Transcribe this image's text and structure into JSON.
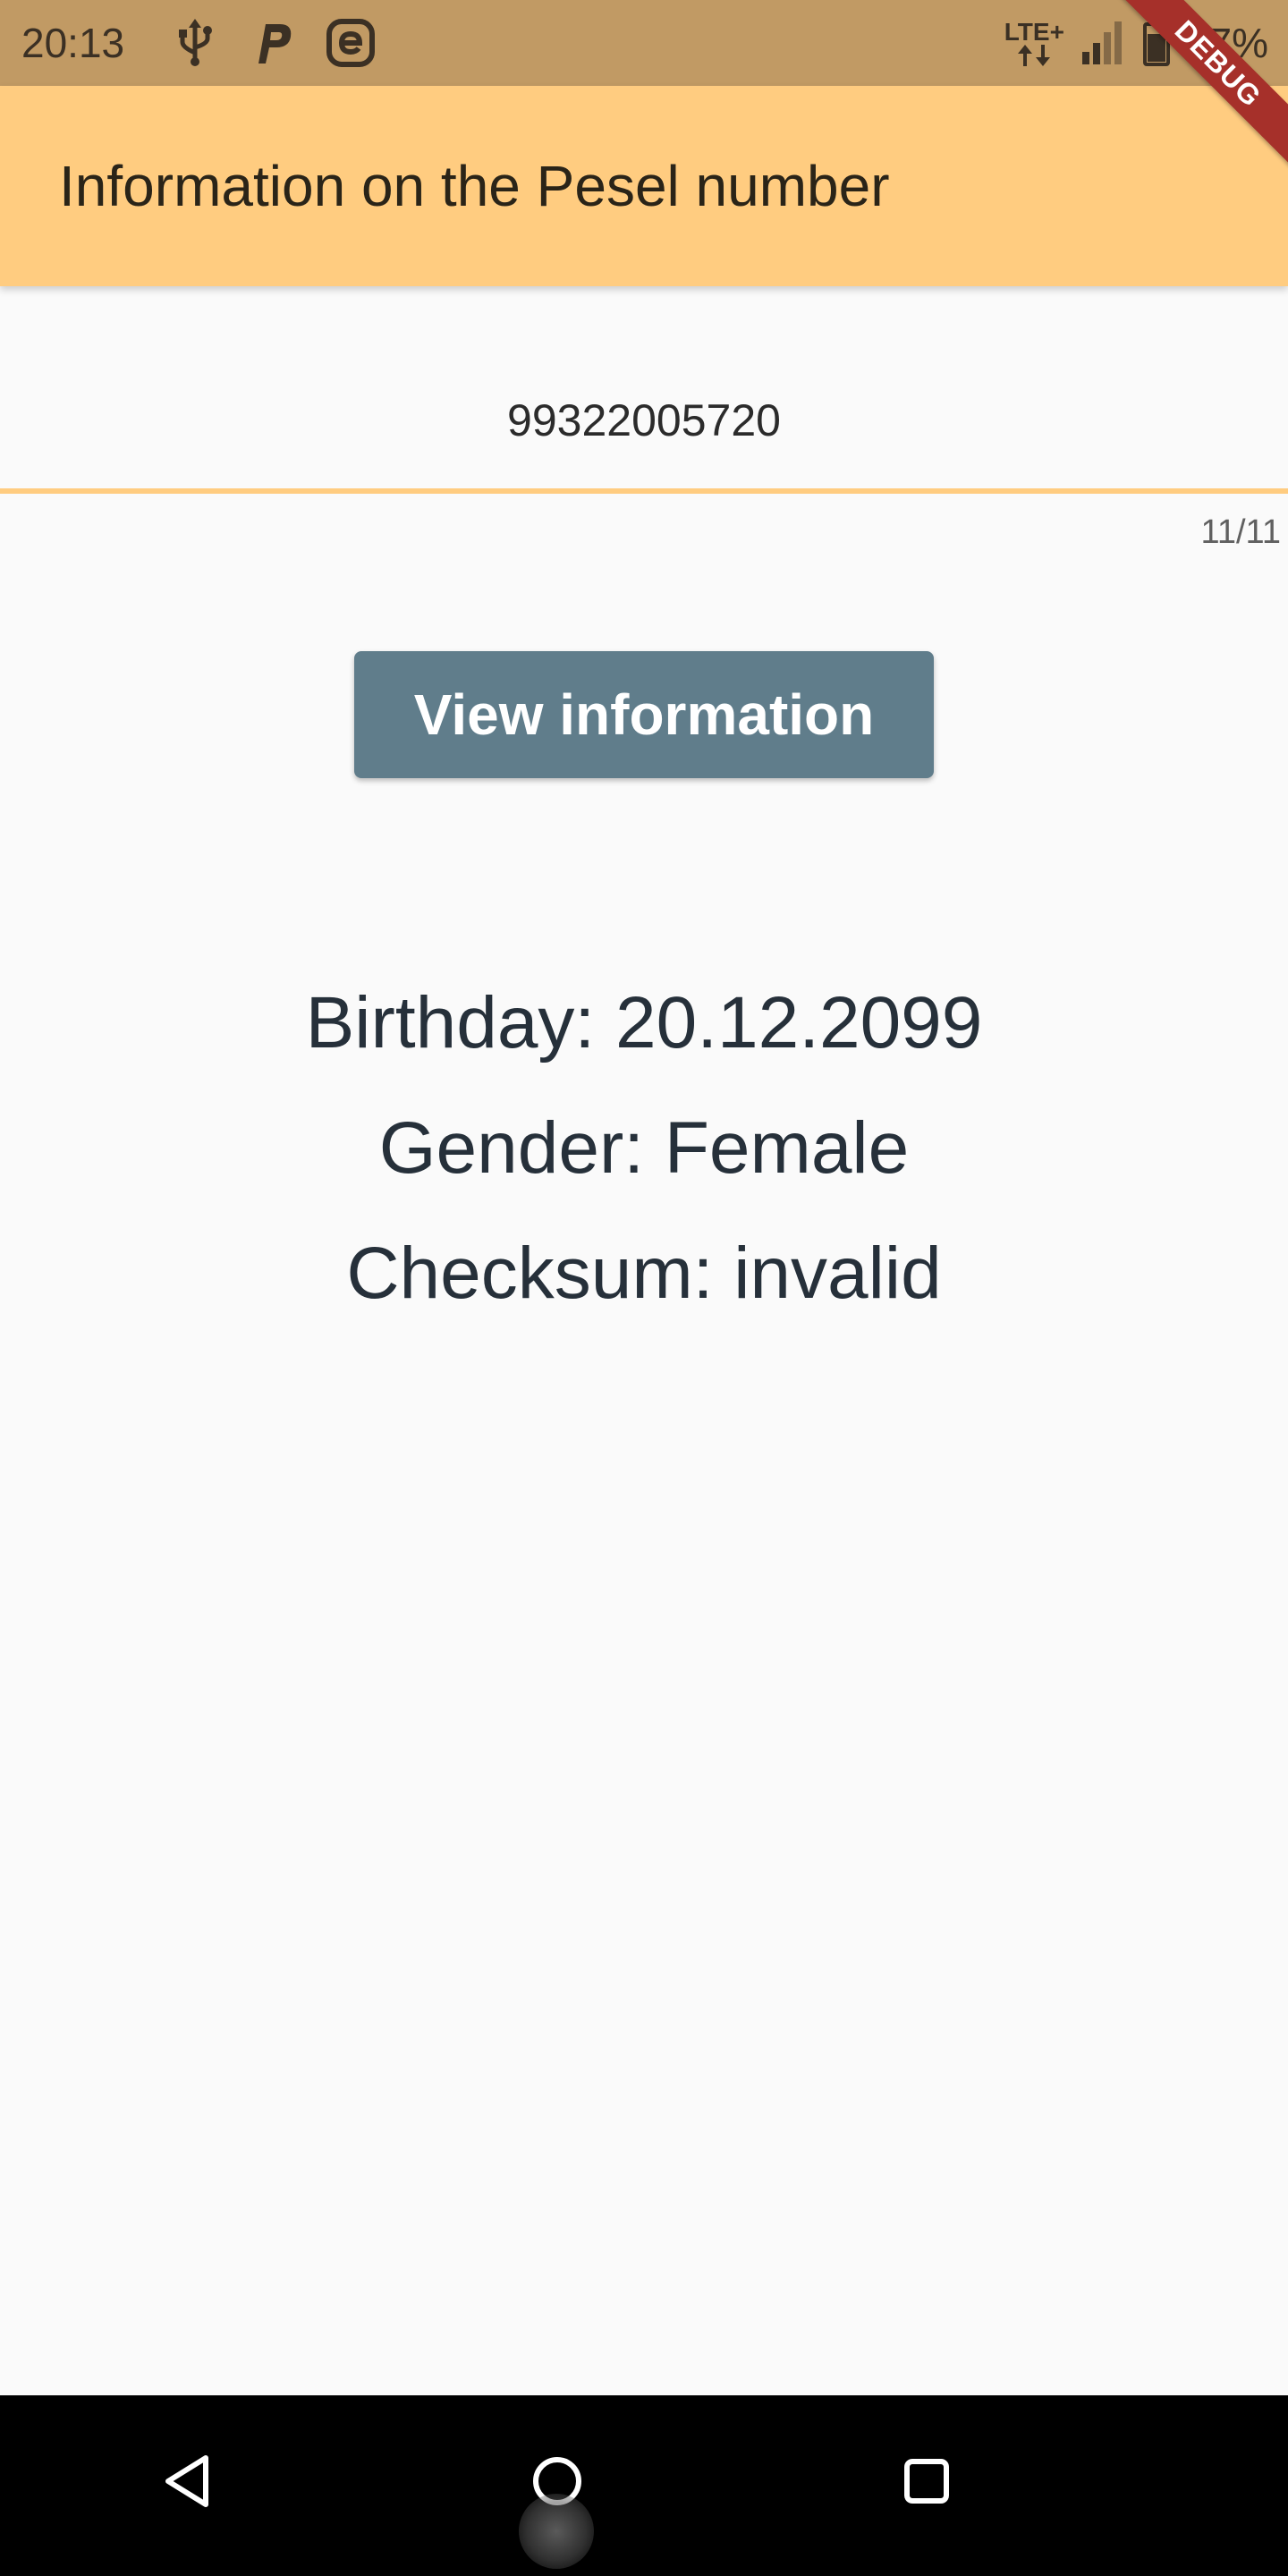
{
  "status_bar": {
    "time": "20:13",
    "network_label": "LTE+",
    "battery": "77%",
    "icons": [
      "usb-icon",
      "parking-icon",
      "e-app-icon",
      "lte-icon",
      "signal-icon",
      "battery-icon"
    ]
  },
  "debug_banner": "DEBUG",
  "app_bar": {
    "title": "Information on the Pesel number"
  },
  "pesel_input": {
    "value": "99322005720",
    "counter": "11/11"
  },
  "view_button": {
    "label": "View information"
  },
  "results": {
    "birthday": "Birthday: 20.12.2099",
    "gender": "Gender: Female",
    "checksum": "Checksum: invalid"
  },
  "nav_bar": {
    "icons": [
      "back-icon",
      "home-icon",
      "recents-icon"
    ]
  },
  "colors": {
    "status_bar": "#c19a64",
    "app_bar": "#ffcc80",
    "button": "#607d8b",
    "debug_banner": "#a6302a",
    "text": "#26303a"
  }
}
